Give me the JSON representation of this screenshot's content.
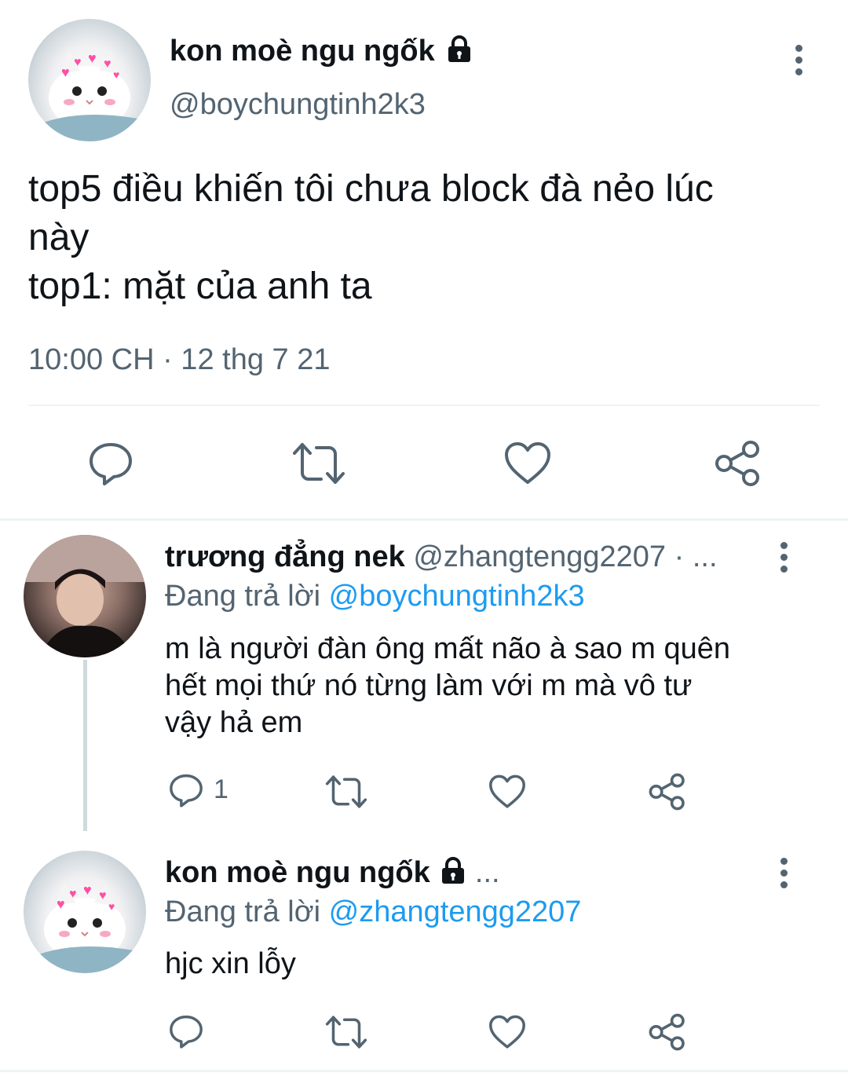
{
  "main_tweet": {
    "display_name": "kon moè ngu ngốk",
    "handle": "@boychungtinh2k3",
    "text_line1": "top5 điều khiến tôi chưa block đà nẻo lúc",
    "text_line2": "này",
    "text_line3": "top1: mặt của anh ta",
    "timestamp": "10:00 CH · 12 thg 7 21",
    "avatar_icon": "cat-avatar",
    "locked_icon": "lock-icon"
  },
  "reply1": {
    "display_name": "trương đẳng nek",
    "handle_trail": "@zhangtengg2207 · ...",
    "replying_prefix": "Đang trả lời",
    "replying_to": "@boychungtinh2k3",
    "text_line1": "m là người đàn ông mất não à sao m quên",
    "text_line2": "hết mọi thứ nó từng làm với m mà vô tư",
    "text_line3": "vậy hả em",
    "reply_count": "1"
  },
  "reply2": {
    "display_name": "kon moè ngu ngốk",
    "trail": "...",
    "replying_prefix": "Đang trả lời",
    "replying_to": "@zhangtengg2207",
    "text": "hjc xin lỗy"
  },
  "colors": {
    "text": "#0f1419",
    "secondary": "#536471",
    "link": "#1d9bf0",
    "divider": "#eff3f4"
  }
}
